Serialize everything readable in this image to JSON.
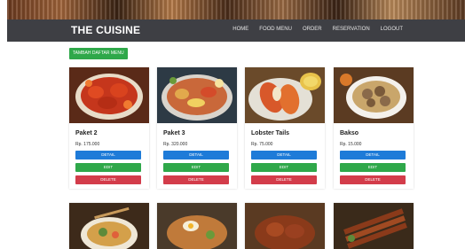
{
  "header": {
    "brand": "THE CUISINE",
    "nav": [
      "HOME",
      "FOOD MENU",
      "ORDER",
      "RESERVATION",
      "LOGOUT"
    ]
  },
  "actions": {
    "add_menu": "TAMBAH DAFTAR MENU"
  },
  "menu_items": [
    {
      "name": "Paket 2",
      "price": "Rp. 175.000"
    },
    {
      "name": "Paket 3",
      "price": "Rp. 320.000"
    },
    {
      "name": "Lobster Tails",
      "price": "Rp. 75.000"
    },
    {
      "name": "Bakso",
      "price": "Rp. 15.000"
    }
  ],
  "buttons": {
    "detail": "DETAIL",
    "edit": "EDIT",
    "delete": "DELETE"
  },
  "colors": {
    "navbar": "#3e3f44",
    "detail": "#1e7bd8",
    "edit": "#2fa84a",
    "delete": "#d33c4a"
  }
}
